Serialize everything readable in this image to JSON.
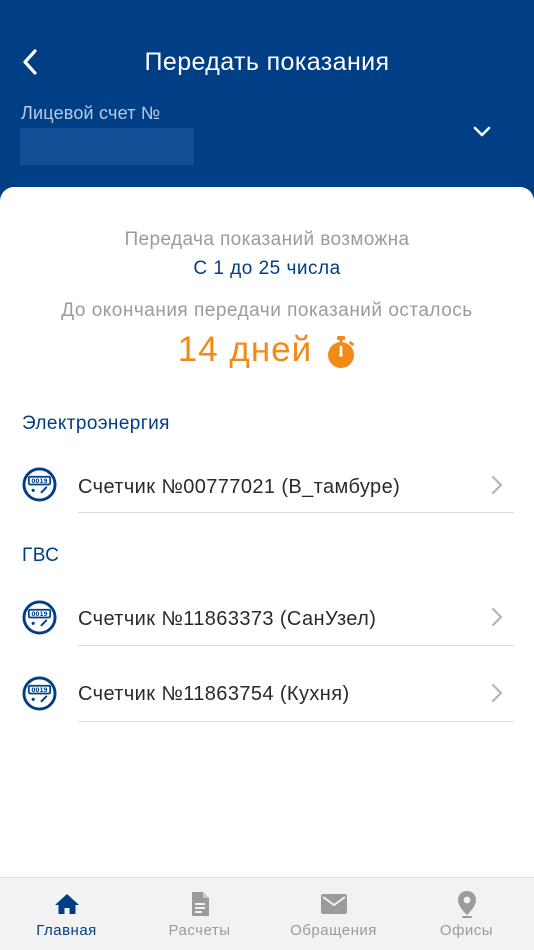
{
  "header": {
    "title": "Передать показания",
    "account_label": "Лицевой счет №",
    "account_value": ""
  },
  "info": {
    "period_text": "Передача показаний возможна",
    "period_range": "С 1 до 25 числа",
    "remaining_text": "До окончания передачи показаний осталось",
    "remaining_days": "14 дней"
  },
  "sections": [
    {
      "title": "Электроэнергия",
      "meters": [
        {
          "label": "Счетчик №00777021 (В_тамбуре)",
          "icon": "meter-icon",
          "display": "0019"
        }
      ]
    },
    {
      "title": "ГВС",
      "meters": [
        {
          "label": "Счетчик №11863373 (СанУзел)",
          "icon": "meter-icon",
          "display": "0019"
        },
        {
          "label": "Счетчик №11863754 (Кухня)",
          "icon": "meter-icon",
          "display": "0019"
        }
      ]
    }
  ],
  "tabbar": {
    "items": [
      {
        "label": "Главная",
        "icon": "home-icon",
        "active": true
      },
      {
        "label": "Расчеты",
        "icon": "document-icon",
        "active": false
      },
      {
        "label": "Обращения",
        "icon": "mail-icon",
        "active": false
      },
      {
        "label": "Офисы",
        "icon": "location-pin-icon",
        "active": false
      }
    ]
  },
  "colors": {
    "brand": "#003e85",
    "accent": "#f28a18",
    "muted": "#9b9b9b",
    "tab_inactive": "#9b9b9b"
  }
}
